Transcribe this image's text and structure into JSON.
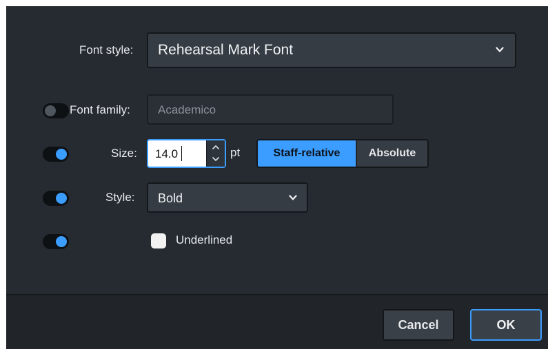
{
  "dialog": {
    "font_style": {
      "label": "Font style:",
      "value": "Rehearsal Mark Font",
      "chevron_icon": "chevron-down-icon"
    },
    "font_family": {
      "label": "Font family:",
      "placeholder": "Academico",
      "override_enabled": false
    },
    "size": {
      "label": "Size:",
      "value": "14.0",
      "unit": "pt",
      "override_enabled": true,
      "modes": [
        "Staff-relative",
        "Absolute"
      ],
      "selected_mode": "Staff-relative"
    },
    "style": {
      "label": "Style:",
      "value": "Bold",
      "override_enabled": true,
      "chevron_icon": "chevron-down-icon"
    },
    "underlined": {
      "label": "Underlined",
      "checked": false,
      "override_enabled": true
    }
  },
  "footer": {
    "cancel_label": "Cancel",
    "ok_label": "OK"
  },
  "colors": {
    "background": "#262b31",
    "accent": "#3b9dff",
    "control": "#363c44"
  }
}
